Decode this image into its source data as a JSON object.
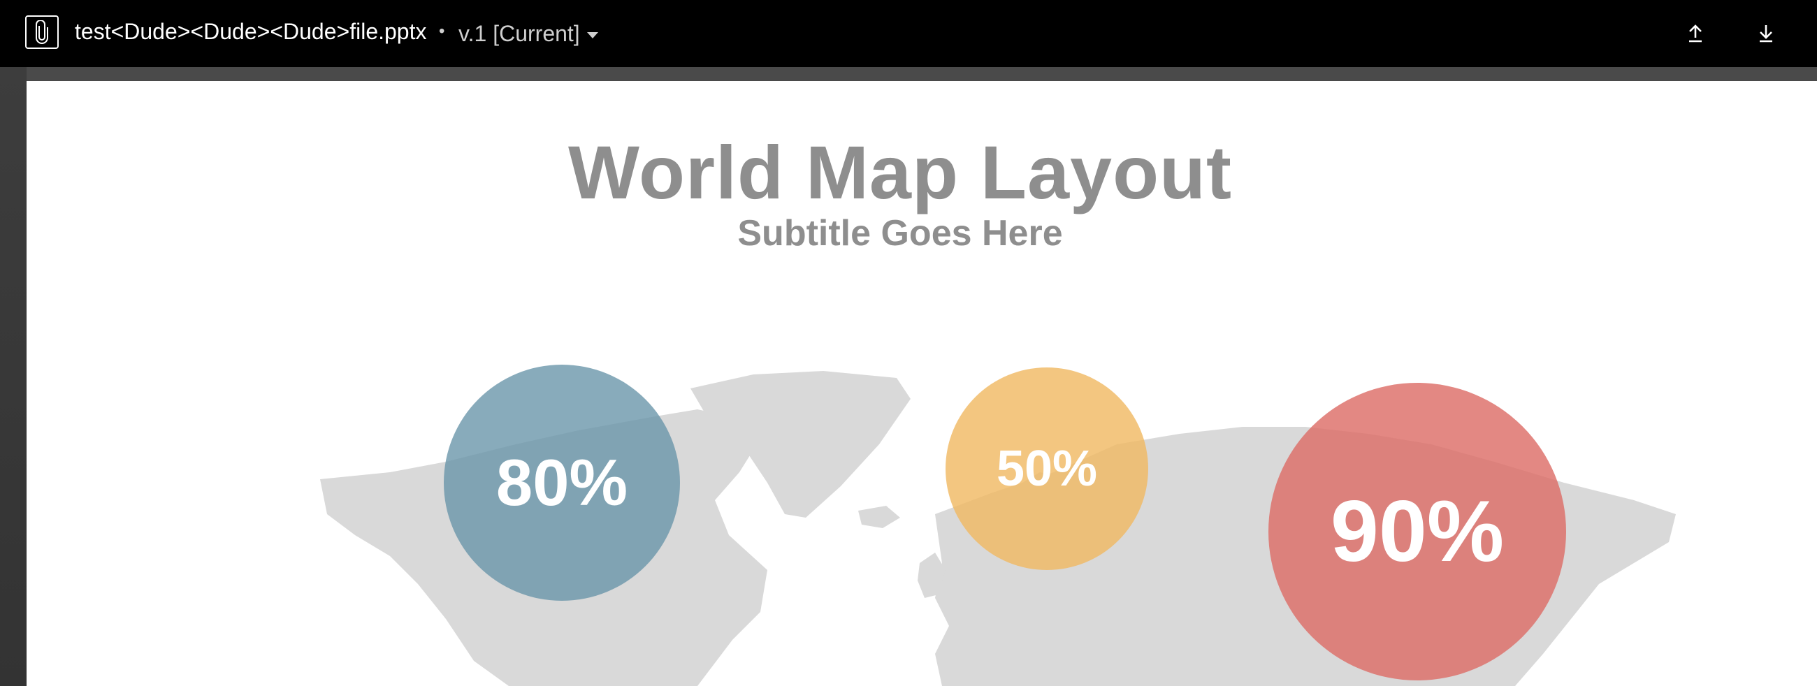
{
  "header": {
    "file_name": "test<Dude><Dude><Dude>file.pptx",
    "separator": "•",
    "version_label": "v.1 [Current]",
    "icons": {
      "app": "paperclip-icon",
      "upload": "upload-icon",
      "download": "download-icon"
    }
  },
  "slide": {
    "title": "World Map Layout",
    "subtitle": "Subtitle Goes Here",
    "bubbles": [
      {
        "value": "80%",
        "color": "#6694a8"
      },
      {
        "value": "50%",
        "color": "#f0b964"
      },
      {
        "value": "90%",
        "color": "#dd6e68"
      }
    ],
    "map_color": "#d9d9d9"
  }
}
